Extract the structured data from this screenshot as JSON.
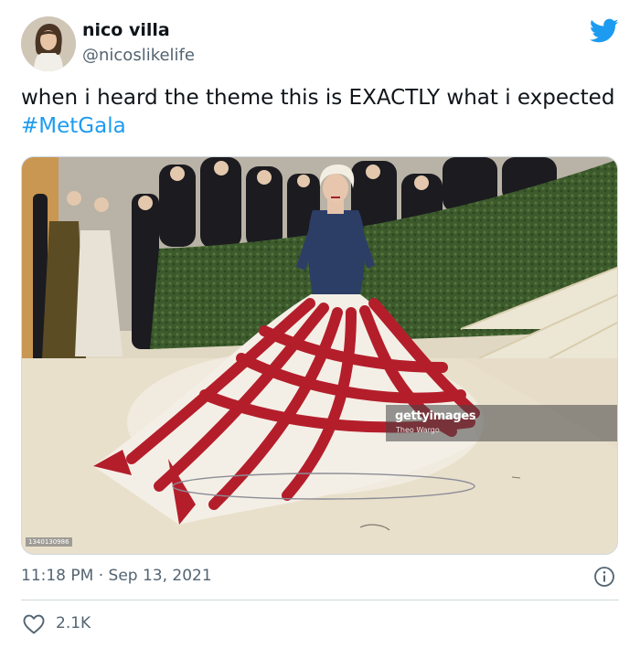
{
  "tweet": {
    "author_name": "nico villa",
    "author_handle": "@nicoslikelife",
    "text_prefix": "when i heard the theme this is EXACTLY what i expected ",
    "hashtag": "#MetGala",
    "timestamp": "11:18 PM · Sep 13, 2021",
    "like_count": "2.1K"
  },
  "media": {
    "watermark_brand": "gettyimages",
    "watermark_credit": "Theo Wargo",
    "photo_id": "1340130986"
  },
  "icons": {
    "brand": "twitter-bird-icon",
    "info": "info-icon",
    "like": "heart-icon"
  },
  "colors": {
    "accent": "#1d9bf0",
    "secondary_text": "#536471",
    "primary_text": "#0f1419",
    "divider": "#cfd9de"
  }
}
